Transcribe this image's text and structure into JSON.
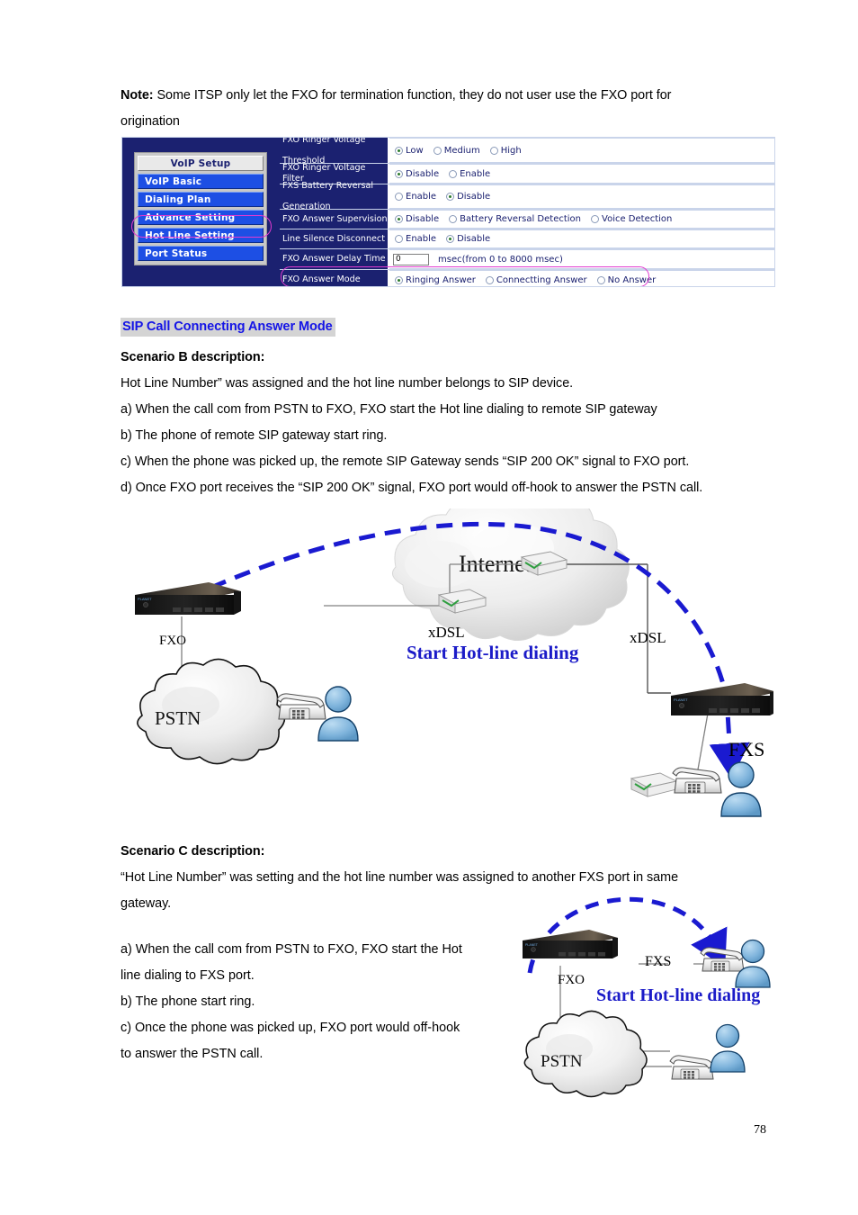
{
  "document": {
    "page_number": "78",
    "note_prefix": "Note:",
    "note_text": " Some ITSP only let the FXO for termination function, they do not user use the FXO port for",
    "note_line2": "origination",
    "section_heading": "SIP Call Connecting Answer Mode",
    "scenario_b": {
      "title": "Scenario B description:",
      "intro": "Hot Line Number” was assigned and the hot line number belongs to SIP device.",
      "steps": [
        "a) When the call com from PSTN to FXO, FXO start the Hot line dialing to remote SIP gateway",
        "b) The phone of remote SIP gateway start ring.",
        "c) When the phone was picked up, the remote SIP Gateway sends “SIP 200 OK” signal to FXO port.",
        "d) Once FXO port receives the “SIP 200 OK” signal, FXO port would off-hook to answer the PSTN call."
      ]
    },
    "scenario_c": {
      "title": "Scenario C description:",
      "intro_line1": "“Hot Line Number” was setting and the hot line number was assigned to another FXS port in same",
      "intro_line2": "gateway.",
      "steps": [
        "a) When the call com from PSTN to FXO, FXO start the Hot",
        "line dialing to FXS port.",
        "b) The phone start ring.",
        "c) Once the phone was picked up, FXO port would off-hook",
        "to answer the PSTN call."
      ]
    }
  },
  "colors": {
    "menu_blue": "#1d4fe4",
    "panel_navy": "#1b2170",
    "highlight_pink": "#e23ad0",
    "heading_blue": "#1414e6",
    "heading_bg": "#d4d4d4",
    "diagram_blue": "#1b1bc8"
  },
  "router_ui": {
    "menu": {
      "header_label": "VoIP Setup",
      "items": [
        {
          "label": "VoIP Basic",
          "selected": false
        },
        {
          "label": "Dialing Plan",
          "selected": false
        },
        {
          "label": "Advance Setting",
          "selected": true
        },
        {
          "label": "Hot Line Setting",
          "selected": false
        },
        {
          "label": "Port Status",
          "selected": false
        }
      ]
    },
    "settings": [
      {
        "label_line1": "FXO Ringer Voltage",
        "label_line2": "Threshold",
        "type": "radio",
        "options": [
          {
            "label": "Low",
            "checked": true
          },
          {
            "label": "Medium",
            "checked": false
          },
          {
            "label": "High",
            "checked": false
          }
        ]
      },
      {
        "label_line1": "FXO Ringer Voltage Filter",
        "label_line2": "",
        "type": "radio",
        "options": [
          {
            "label": "Disable",
            "checked": true
          },
          {
            "label": "Enable",
            "checked": false
          }
        ]
      },
      {
        "label_line1": "FXS Battery Reversal",
        "label_line2": "Generation",
        "type": "radio",
        "options": [
          {
            "label": "Enable",
            "checked": false
          },
          {
            "label": "Disable",
            "checked": true
          }
        ]
      },
      {
        "label_line1": "FXO Answer Supervision",
        "label_line2": "",
        "type": "radio",
        "options": [
          {
            "label": "Disable",
            "checked": true
          },
          {
            "label": "Battery Reversal Detection",
            "checked": false
          },
          {
            "label": "Voice Detection",
            "checked": false
          }
        ]
      },
      {
        "label_line1": "Line Silence Disconnect",
        "label_line2": "",
        "type": "radio",
        "options": [
          {
            "label": "Enable",
            "checked": false
          },
          {
            "label": "Disable",
            "checked": true
          }
        ]
      },
      {
        "label_line1": "FXO Answer Delay Time",
        "label_line2": "",
        "type": "input",
        "value": "0",
        "suffix": "msec(from 0 to 8000 msec)"
      },
      {
        "label_line1": "FXO Answer Mode",
        "label_line2": "",
        "type": "radio",
        "highlighted": true,
        "options": [
          {
            "label": "Ringing Answer",
            "checked": true
          },
          {
            "label": "Connectting Answer",
            "checked": false
          },
          {
            "label": "No Answer",
            "checked": false
          }
        ]
      }
    ]
  },
  "diagram_b": {
    "labels": {
      "internet": "Internet",
      "fxo": "FXO",
      "xdsl_left": "xDSL",
      "xdsl_right": "xDSL",
      "pstn": "PSTN",
      "fxs": "FXS",
      "callout": "Start Hot-line dialing"
    }
  },
  "diagram_c": {
    "labels": {
      "fxo": "FXO",
      "fxs": "FXS",
      "pstn": "PSTN",
      "callout": "Start Hot-line dialing"
    }
  }
}
